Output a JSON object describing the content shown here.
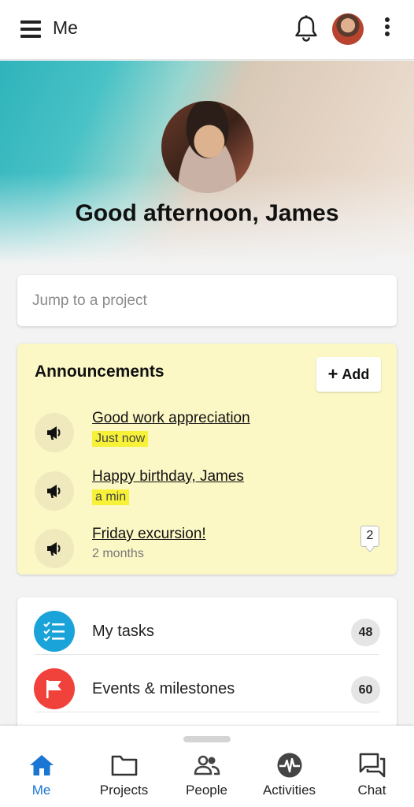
{
  "appbar": {
    "title": "Me",
    "menu_icon": "hamburger-menu-icon",
    "notification_icon": "bell-icon",
    "more_icon": "kebab-menu-icon"
  },
  "hero": {
    "greeting_prefix": "Good afternoon, ",
    "user_name": "James"
  },
  "search": {
    "placeholder": "Jump to a project"
  },
  "announcements": {
    "title": "Announcements",
    "add_label": "Add",
    "items": [
      {
        "title": "Good work appreciation",
        "time": "Just now",
        "highlighted": true,
        "comments": ""
      },
      {
        "title": "Happy birthday, James",
        "time": "a min",
        "highlighted": true,
        "comments": ""
      },
      {
        "title": "Friday excursion!",
        "time": "2 months",
        "highlighted": false,
        "comments": "2"
      }
    ],
    "colors": {
      "card_bg": "#fcf8c6",
      "highlight": "#f7f237"
    }
  },
  "quick_links": [
    {
      "label": "My tasks",
      "count": "48",
      "icon": "checklist-icon",
      "color": "#1aa3d9"
    },
    {
      "label": "Events & milestones",
      "count": "60",
      "icon": "flag-icon",
      "color": "#f0413a"
    }
  ],
  "bottom_nav": [
    {
      "label": "Me",
      "icon": "home-icon",
      "active": true
    },
    {
      "label": "Projects",
      "icon": "folder-icon",
      "active": false
    },
    {
      "label": "People",
      "icon": "people-icon",
      "active": false
    },
    {
      "label": "Activities",
      "icon": "activity-pulse-icon",
      "active": false
    },
    {
      "label": "Chat",
      "icon": "chat-icon",
      "active": false
    }
  ],
  "accent_color": "#1976d2"
}
